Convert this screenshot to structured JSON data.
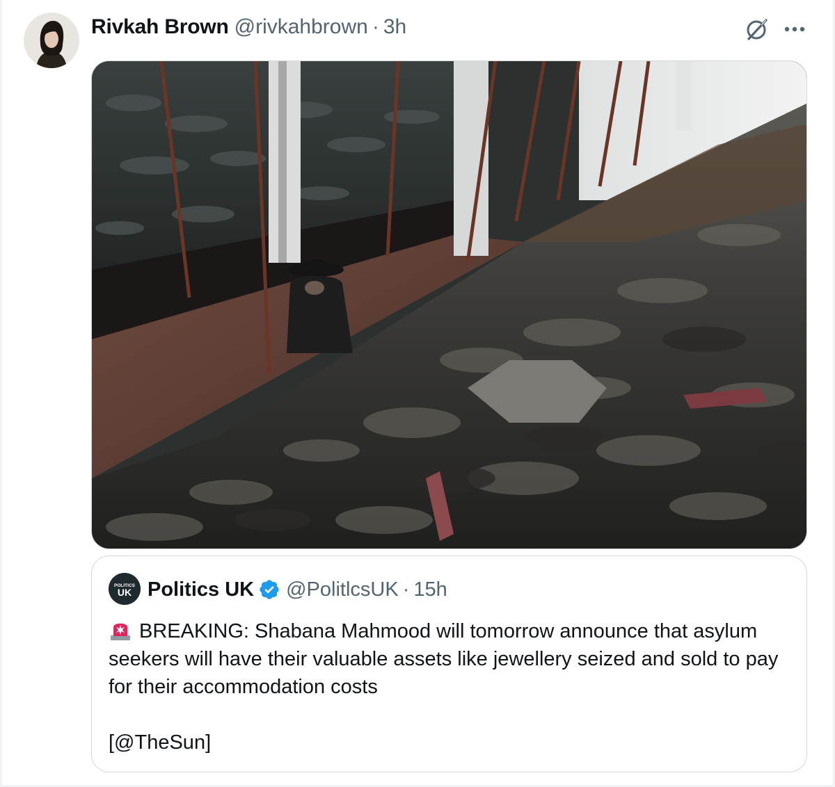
{
  "tweet": {
    "author_name": "Rivkah Brown",
    "author_handle": "@rivkahbrown",
    "separator": "·",
    "time": "3h"
  },
  "quoted_tweet": {
    "author_name": "Politics UK",
    "author_handle": "@PolitlcsUK",
    "separator": "·",
    "time": "15h",
    "avatar_text_top": "POLITICS",
    "avatar_text_bottom": "UK",
    "emoji": "🚨",
    "body": "BREAKING: Shabana Mahmood will tomorrow announce that asylum seekers will have their valuable assets like jewellery seized and sold to pay for their accommodation costs",
    "source": "[@TheSun]"
  },
  "icons": {
    "grok": "grok-icon",
    "more": "more-icon",
    "verified": "verified-badge-icon",
    "siren": "siren-emoji-icon"
  },
  "colors": {
    "text_primary": "#0f1419",
    "text_secondary": "#536471",
    "border": "#cfd9de",
    "verified_blue": "#1d9bf0"
  }
}
